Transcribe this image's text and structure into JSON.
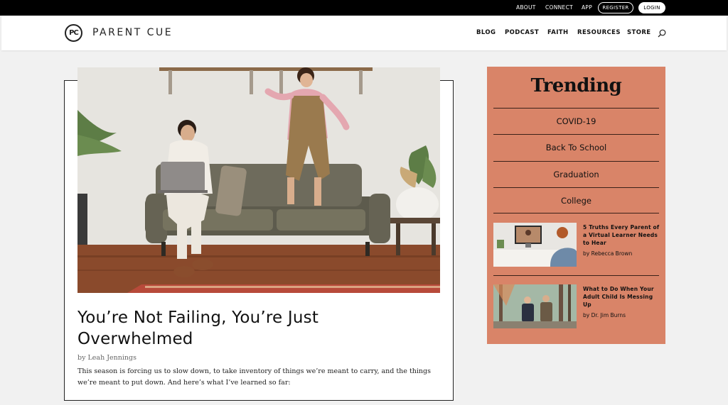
{
  "topbar": {
    "links": [
      "ABOUT",
      "CONNECT",
      "APP"
    ],
    "register_label": "REGISTER",
    "login_label": "LOGIN"
  },
  "header": {
    "logo_mark": "PC",
    "logo_text": "PARENT CUE",
    "nav": [
      "BLOG",
      "PODCAST",
      "FAITH",
      "RESOURCES",
      "STORE"
    ],
    "search_icon": "search-icon"
  },
  "article": {
    "title": "You’re Not Failing, You’re Just Overwhelmed",
    "byline": "by Leah Jennings",
    "excerpt": "This season is forcing us to slow down, to take inventory of things we’re meant to carry, and the things we’re meant to put down. And here’s what I’ve learned so far:"
  },
  "trending": {
    "title": "Trending",
    "topics": [
      "COVID-19",
      "Back To School",
      "Graduation",
      "College"
    ],
    "posts": [
      {
        "title": "5 Truths Every Parent of a Virtual Learner Needs to Hear",
        "author": "by Rebecca Brown"
      },
      {
        "title": "What to Do When Your Adult Child Is Messing Up",
        "author": "by Dr. Jim Burns"
      }
    ]
  },
  "colors": {
    "topbar": "#000000",
    "trending_bg": "#d98468",
    "text": "#111111"
  }
}
